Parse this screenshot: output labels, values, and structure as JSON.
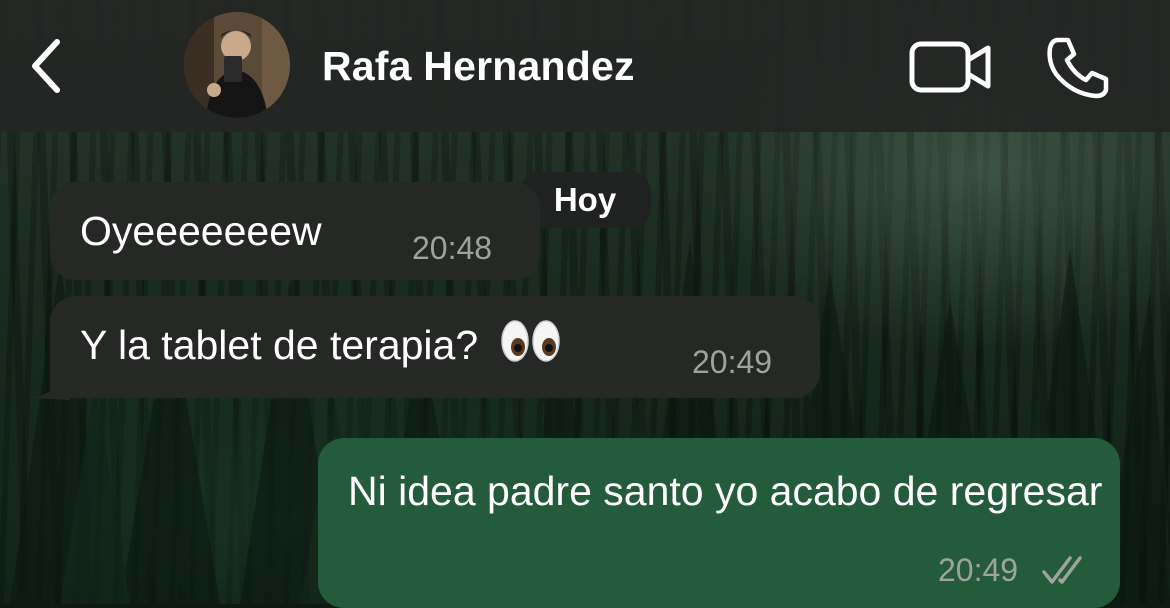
{
  "header": {
    "contact_name": "Rafa Hernandez",
    "back_icon": "chevron-left-icon",
    "video_icon": "video-camera-icon",
    "call_icon": "phone-icon"
  },
  "chat": {
    "date_separator": "Hoy",
    "messages": [
      {
        "direction": "incoming",
        "text": "Oyeeeeeeew",
        "time": "20:48"
      },
      {
        "direction": "incoming",
        "text": "Y la tablet de terapia?",
        "emoji": "👀",
        "time": "20:49"
      },
      {
        "direction": "outgoing",
        "text": "Ni idea padre santo yo acabo de regresar",
        "time": "20:49",
        "status": "read-double-check"
      }
    ]
  },
  "colors": {
    "header_bg": "#242624",
    "incoming_bubble": "#262826",
    "outgoing_bubble": "#245b3b",
    "timestamp": "#9ea39f"
  }
}
